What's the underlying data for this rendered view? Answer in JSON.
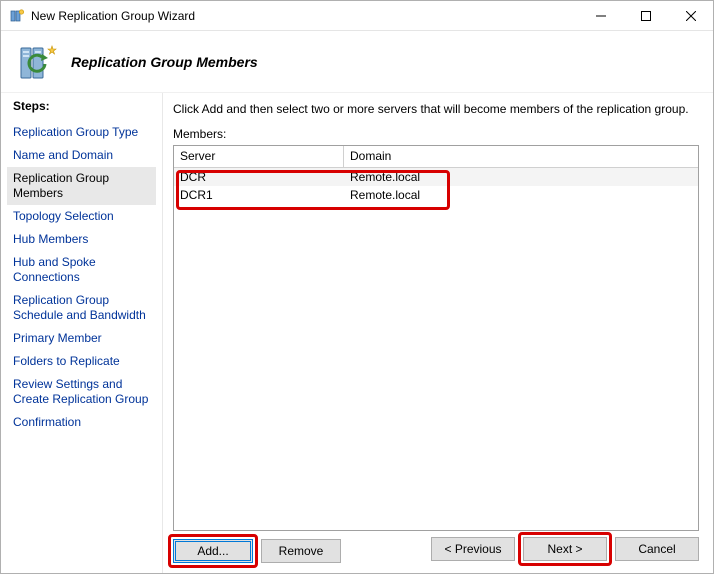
{
  "window": {
    "title": "New Replication Group Wizard"
  },
  "header": {
    "title": "Replication Group Members"
  },
  "sidebar": {
    "label": "Steps:",
    "items": [
      {
        "label": "Replication Group Type",
        "current": false
      },
      {
        "label": "Name and Domain",
        "current": false
      },
      {
        "label": "Replication Group Members",
        "current": true
      },
      {
        "label": "Topology Selection",
        "current": false
      },
      {
        "label": "Hub Members",
        "current": false
      },
      {
        "label": "Hub and Spoke Connections",
        "current": false
      },
      {
        "label": "Replication Group Schedule and Bandwidth",
        "current": false
      },
      {
        "label": "Primary Member",
        "current": false
      },
      {
        "label": "Folders to Replicate",
        "current": false
      },
      {
        "label": "Review Settings and Create Replication Group",
        "current": false
      },
      {
        "label": "Confirmation",
        "current": false
      }
    ]
  },
  "main": {
    "instructions": "Click Add and then select two or more servers that will become members of the replication group.",
    "members_label": "Members:",
    "columns": {
      "server": "Server",
      "domain": "Domain"
    },
    "rows": [
      {
        "server": "DCR",
        "domain": "Remote.local"
      },
      {
        "server": "DCR1",
        "domain": "Remote.local"
      }
    ],
    "add_label": "Add...",
    "remove_label": "Remove"
  },
  "footer": {
    "previous": "< Previous",
    "next": "Next >",
    "cancel": "Cancel"
  }
}
